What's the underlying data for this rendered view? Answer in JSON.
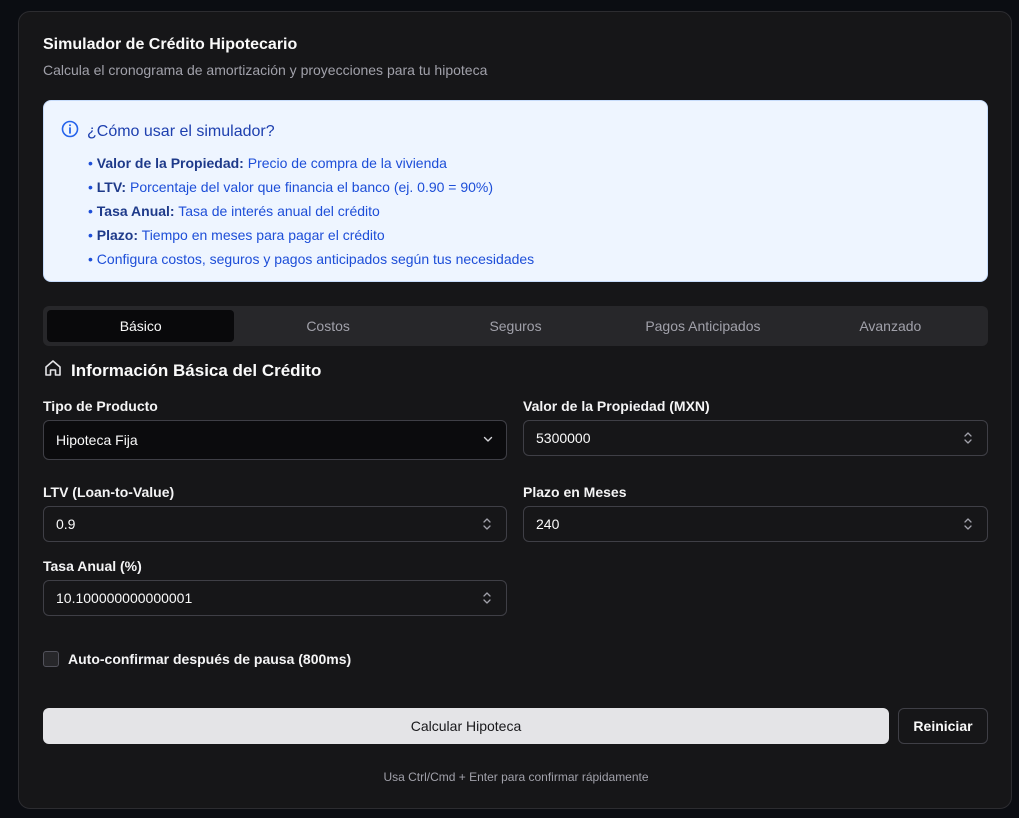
{
  "header": {
    "title": "Simulador de Crédito Hipotecario",
    "subtitle": "Calcula el cronograma de amortización y proyecciones para tu hipoteca"
  },
  "info": {
    "icon": "info-circle-icon",
    "title": "¿Cómo usar el simulador?",
    "items": [
      {
        "bold": "Valor de la Propiedad:",
        "text": " Precio de compra de la vivienda"
      },
      {
        "bold": "LTV:",
        "text": " Porcentaje del valor que financia el banco (ej. 0.90 = 90%)"
      },
      {
        "bold": "Tasa Anual:",
        "text": " Tasa de interés anual del crédito"
      },
      {
        "bold": "Plazo:",
        "text": " Tiempo en meses para pagar el crédito"
      },
      {
        "bold": "",
        "text": "Configura costos, seguros y pagos anticipados según tus necesidades"
      }
    ]
  },
  "tabs": [
    {
      "label": "Básico",
      "active": true
    },
    {
      "label": "Costos",
      "active": false
    },
    {
      "label": "Seguros",
      "active": false
    },
    {
      "label": "Pagos Anticipados",
      "active": false
    },
    {
      "label": "Avanzado",
      "active": false
    }
  ],
  "section": {
    "icon": "home-icon",
    "title": "Información Básica del Crédito"
  },
  "form": {
    "product_type": {
      "label": "Tipo de Producto",
      "value": "Hipoteca Fija"
    },
    "property_value": {
      "label": "Valor de la Propiedad (MXN)",
      "value": "5300000"
    },
    "ltv": {
      "label": "LTV (Loan-to-Value)",
      "value": "0.9"
    },
    "term": {
      "label": "Plazo en Meses",
      "value": "240"
    },
    "rate": {
      "label": "Tasa Anual (%)",
      "value": "10.100000000000001"
    }
  },
  "auto_confirm": {
    "label": "Auto-confirmar después de pausa (800ms)",
    "checked": false
  },
  "actions": {
    "calculate_label": "Calcular Hipoteca",
    "reset_label": "Reiniciar",
    "hint": "Usa Ctrl/Cmd + Enter para confirmar rápidamente"
  },
  "colors": {
    "background": "#0b0d12",
    "card": "#161618",
    "info_bg": "#eef5ff",
    "info_text": "#1d4ed8",
    "primary_button": "#e4e4e7"
  }
}
